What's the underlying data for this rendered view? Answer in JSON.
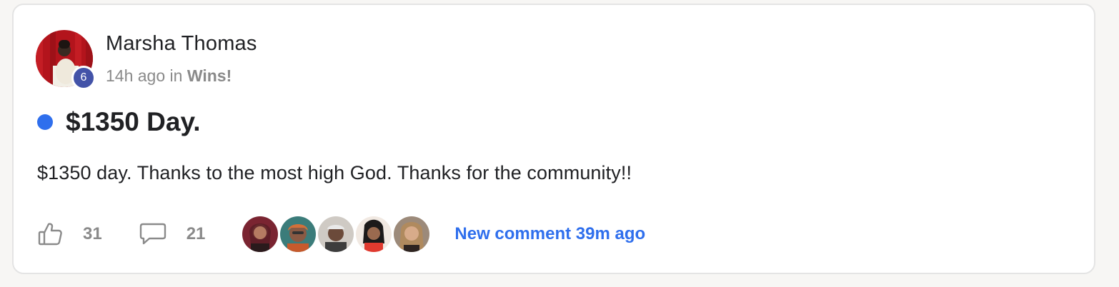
{
  "post": {
    "author": "Marsha Thomas",
    "level": "6",
    "time": "14h ago",
    "in_text": "in",
    "category": "Wins!",
    "title": "$1350 Day.",
    "body": "$1350 day. Thanks to the most high God. Thanks for the community!!",
    "likes": "31",
    "comments": "21",
    "new_comment": "New comment 39m ago",
    "unread": true
  },
  "icons": {
    "like": "thumbs-up-icon",
    "comment": "comment-bubble-icon"
  },
  "colors": {
    "accent": "#2f6fed",
    "level_badge": "#4353a8",
    "muted_text": "#8a8a8a",
    "text": "#202124"
  }
}
